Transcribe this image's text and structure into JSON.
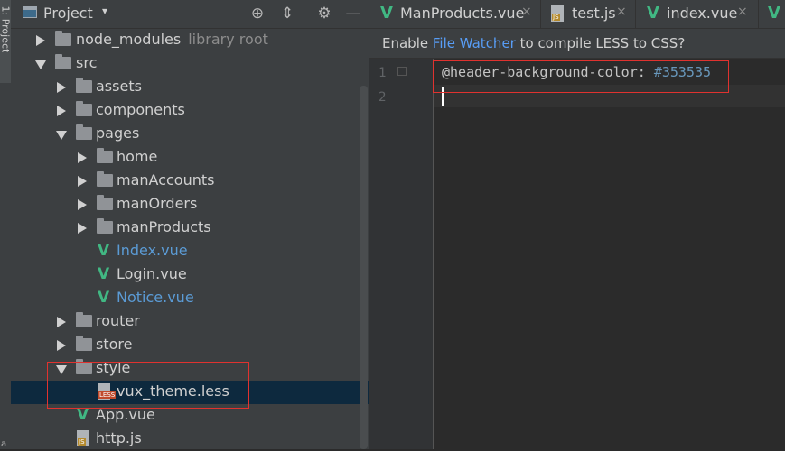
{
  "tool_stripe": {
    "label": "1: Project",
    "bottom_label": "a"
  },
  "project_panel": {
    "title": "Project",
    "dropdown": "▾",
    "buttons": {
      "locate": "⊕",
      "collapse": "⇕",
      "settings": "⚙",
      "hide": "—"
    }
  },
  "tree": {
    "node_modules": {
      "label": "node_modules",
      "hint": "library root"
    },
    "src": "src",
    "assets": "assets",
    "components": "components",
    "pages": "pages",
    "home": "home",
    "manAccounts": "manAccounts",
    "manOrders": "manOrders",
    "manProducts": "manProducts",
    "index_vue": "Index.vue",
    "login_vue": "Login.vue",
    "notice_vue": "Notice.vue",
    "router": "router",
    "store": "store",
    "style": "style",
    "vux_theme": "vux_theme.less",
    "app_vue": "App.vue",
    "http_js": "http.js"
  },
  "file_badges": {
    "less": "LESS",
    "js": "JS"
  },
  "tabs": [
    {
      "label": "ManProducts.vue",
      "close": "×"
    },
    {
      "label": "test.js",
      "close": "×"
    },
    {
      "label": "index.vue",
      "close": "×"
    }
  ],
  "vue_icon_glyph": "V",
  "notification": {
    "prefix": "Enable ",
    "link": "File Watcher",
    "suffix": " to compile LESS to CSS?"
  },
  "editor": {
    "line_numbers": [
      "1",
      "2"
    ],
    "line1_var": "@header-background-color: ",
    "line1_value": "#353535"
  },
  "colors": {
    "vue_green": "#41b883",
    "link_blue": "#589df6",
    "highlight_red": "#e0322f",
    "selection": "#0d293e"
  }
}
